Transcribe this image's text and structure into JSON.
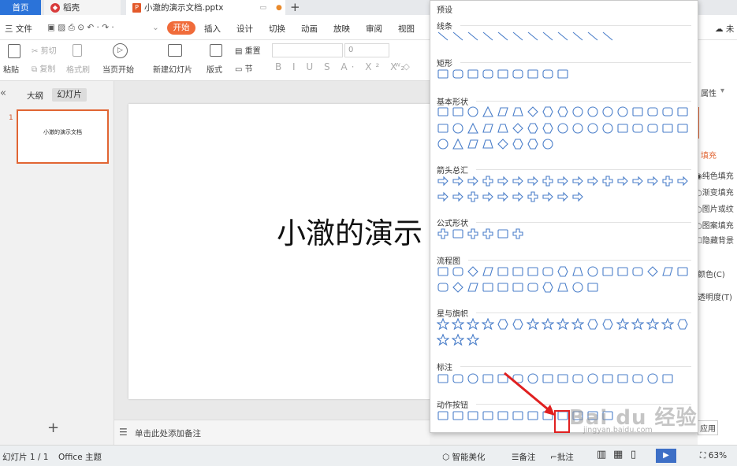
{
  "tabs": {
    "home": "首页",
    "docer": "稻壳",
    "doc": "小澈的演示文档.pptx",
    "new": "+"
  },
  "menubar": {
    "file": "三 文件",
    "items": [
      "开始",
      "插入",
      "设计",
      "切换",
      "动画",
      "放映",
      "审阅",
      "视图"
    ],
    "right_partial": "未"
  },
  "ribbon": {
    "paste": "粘贴",
    "cut": "剪切",
    "copy": "复制",
    "format_painter": "格式刷",
    "play_from_current": "当页开始",
    "new_slide": "新建幻灯片",
    "layout": "版式",
    "section": "节",
    "reset": "重置",
    "font_size_value": "0",
    "shape": "形状"
  },
  "left_panel": {
    "outline": "大纲",
    "slides": "幻灯片",
    "thumb_num": "1",
    "thumb_text": "小澈的演示文档",
    "add": "+"
  },
  "slide": {
    "title": "小澈的演示"
  },
  "notes": {
    "placeholder": "单击此处添加备注"
  },
  "status": {
    "slide_pos": "幻灯片 1 / 1",
    "theme": "Office 主题",
    "beautify": "智能美化",
    "notes": "备注",
    "comments": "批注",
    "zoom": "63%"
  },
  "right_panel": {
    "attr": "属性",
    "fill": "填充",
    "options": [
      "纯色填充",
      "渐变填充",
      "图片或纹",
      "图案填充",
      "隐藏背景"
    ],
    "color": "颜色(C)",
    "transparency": "透明度(T)",
    "apply": "应用"
  },
  "dropdown": {
    "preset": "预设",
    "sections": [
      {
        "title": "线条",
        "rows": [
          12
        ]
      },
      {
        "title": "矩形",
        "rows": [
          9
        ]
      },
      {
        "title": "基本形状",
        "rows": [
          17,
          17,
          8
        ]
      },
      {
        "title": "箭头总汇",
        "rows": [
          17,
          10
        ]
      },
      {
        "title": "公式形状",
        "rows": [
          6
        ]
      },
      {
        "title": "流程图",
        "rows": [
          17,
          11
        ]
      },
      {
        "title": "星与旗帜",
        "rows": [
          17,
          3
        ]
      },
      {
        "title": "标注",
        "rows": [
          16
        ]
      },
      {
        "title": "动作按钮",
        "rows": [
          12
        ]
      }
    ]
  },
  "watermark": {
    "logo": "Bai du 经验",
    "url": "jingyan.baidu.com"
  }
}
